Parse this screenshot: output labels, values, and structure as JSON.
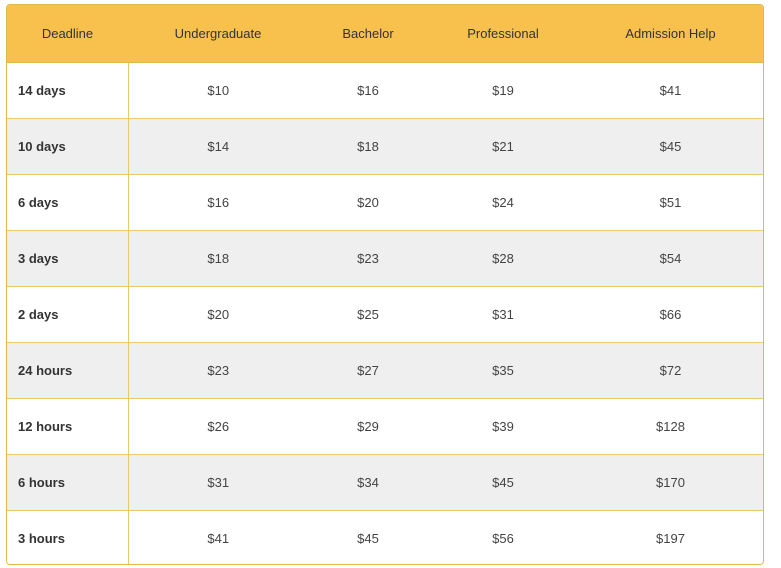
{
  "pricing_table": {
    "headers": [
      "Deadline",
      "Undergraduate",
      "Bachelor",
      "Professional",
      "Admission Help"
    ],
    "rows": [
      {
        "deadline": "14 days",
        "prices": [
          "$10",
          "$16",
          "$19",
          "$41"
        ]
      },
      {
        "deadline": "10 days",
        "prices": [
          "$14",
          "$18",
          "$21",
          "$45"
        ]
      },
      {
        "deadline": "6 days",
        "prices": [
          "$16",
          "$20",
          "$24",
          "$51"
        ]
      },
      {
        "deadline": "3 days",
        "prices": [
          "$18",
          "$23",
          "$28",
          "$54"
        ]
      },
      {
        "deadline": "2 days",
        "prices": [
          "$20",
          "$25",
          "$31",
          "$66"
        ]
      },
      {
        "deadline": "24 hours",
        "prices": [
          "$23",
          "$27",
          "$35",
          "$72"
        ]
      },
      {
        "deadline": "12 hours",
        "prices": [
          "$26",
          "$29",
          "$39",
          "$128"
        ]
      },
      {
        "deadline": "6 hours",
        "prices": [
          "$31",
          "$34",
          "$45",
          "$170"
        ]
      },
      {
        "deadline": "3 hours",
        "prices": [
          "$41",
          "$45",
          "$56",
          "$197"
        ]
      }
    ]
  },
  "colors": {
    "header_bg": "#f8c14e",
    "border": "#e0b84a",
    "stripe": "#efefef"
  }
}
